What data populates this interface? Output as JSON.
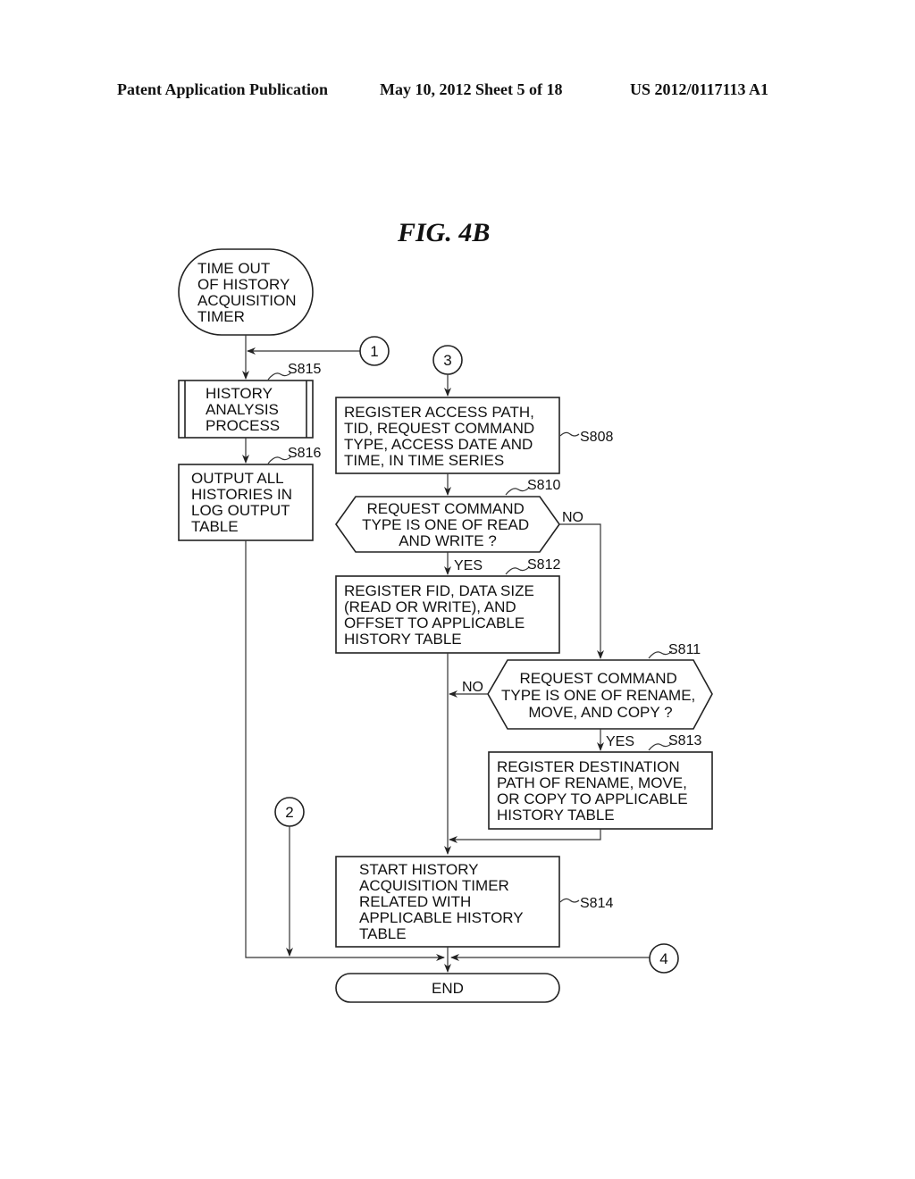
{
  "header": {
    "left": "Patent Application Publication",
    "middle": "May 10, 2012  Sheet 5 of 18",
    "right": "US 2012/0117113 A1"
  },
  "figure": {
    "title": "FIG. 4B"
  },
  "nodes": {
    "start": {
      "lines": [
        "TIME OUT",
        "OF HISTORY",
        "ACQUISITION",
        "TIMER"
      ]
    },
    "s815": {
      "label": "S815",
      "lines": [
        "HISTORY",
        "ANALYSIS",
        "PROCESS"
      ]
    },
    "s816": {
      "label": "S816",
      "lines": [
        "OUTPUT ALL",
        "HISTORIES IN",
        "LOG OUTPUT",
        "TABLE"
      ]
    },
    "s808": {
      "label": "S808",
      "lines": [
        "REGISTER ACCESS PATH,",
        "TID, REQUEST COMMAND",
        "TYPE, ACCESS DATE AND",
        "TIME, IN TIME SERIES"
      ]
    },
    "s810": {
      "label": "S810",
      "lines": [
        "REQUEST COMMAND",
        "TYPE IS ONE OF READ",
        "AND WRITE ?"
      ],
      "yes": "YES",
      "no": "NO"
    },
    "s812": {
      "label": "S812",
      "lines": [
        "REGISTER FID, DATA SIZE",
        "(READ OR WRITE), AND",
        "OFFSET TO APPLICABLE",
        "HISTORY TABLE"
      ]
    },
    "s811": {
      "label": "S811",
      "lines": [
        "REQUEST COMMAND",
        "TYPE IS ONE OF RENAME,",
        "MOVE, AND COPY ?"
      ],
      "yes": "YES",
      "no": "NO"
    },
    "s813": {
      "label": "S813",
      "lines": [
        "REGISTER DESTINATION",
        "PATH OF RENAME, MOVE,",
        "OR COPY TO APPLICABLE",
        "HISTORY TABLE"
      ]
    },
    "s814": {
      "label": "S814",
      "lines": [
        "START HISTORY",
        "ACQUISITION TIMER",
        "RELATED WITH",
        "APPLICABLE HISTORY",
        "TABLE"
      ]
    },
    "end": {
      "lines": [
        "END"
      ]
    }
  },
  "connectors": {
    "c1": "1",
    "c2": "2",
    "c3": "3",
    "c4": "4"
  }
}
